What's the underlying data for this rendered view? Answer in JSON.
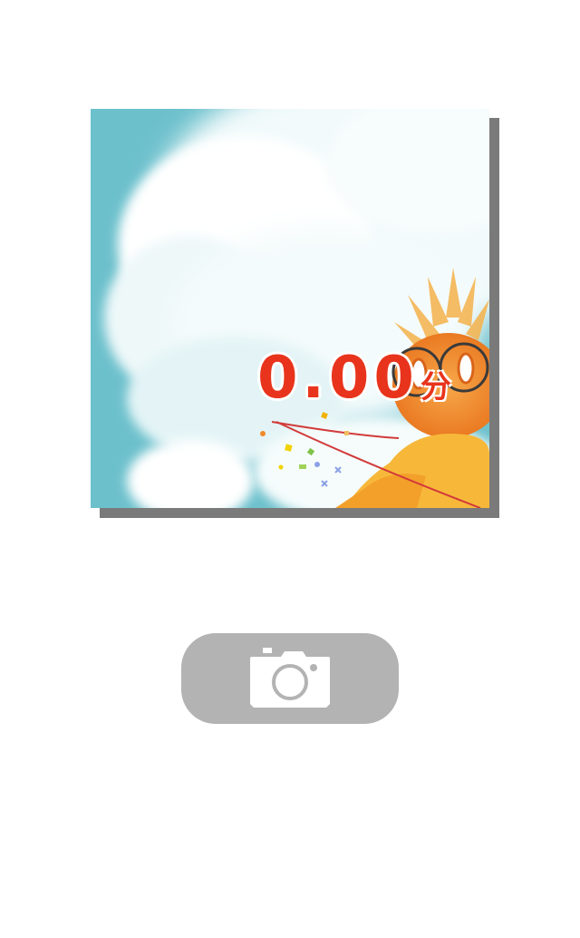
{
  "result": {
    "score_value": "0.00",
    "score_unit": "分",
    "score_color": "#e8341c"
  },
  "background_art": {
    "sky_color": "#6cc0cc",
    "cloud_color": "#ffffff",
    "character_color": "#f08a2a",
    "character": "sun-character-with-glasses"
  },
  "camera_button": {
    "icon": "camera-icon",
    "background_color": "#b3b3b3",
    "icon_color": "#ffffff"
  }
}
